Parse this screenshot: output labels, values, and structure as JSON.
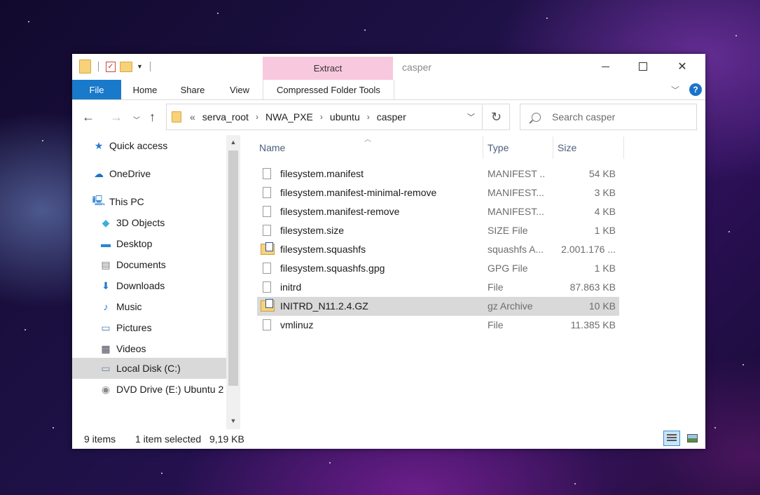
{
  "window": {
    "title": "casper",
    "context_tab_group": "Extract",
    "ribbon_tabs": [
      "File",
      "Home",
      "Share",
      "View",
      "Compressed Folder Tools"
    ],
    "accent_color": "#1979ca",
    "context_color": "#f8c8de"
  },
  "address": {
    "lead": "«",
    "crumbs": [
      "serva_root",
      "NWA_PXE",
      "ubuntu",
      "casper"
    ]
  },
  "search": {
    "placeholder": "Search casper"
  },
  "nav": {
    "items": [
      {
        "label": "Quick access",
        "icon": "star-icon"
      },
      {
        "label": "OneDrive",
        "icon": "cloud-icon"
      },
      {
        "label": "This PC",
        "icon": "computer-icon"
      },
      {
        "label": "3D Objects",
        "icon": "cube-icon"
      },
      {
        "label": "Desktop",
        "icon": "desktop-icon"
      },
      {
        "label": "Documents",
        "icon": "document-icon"
      },
      {
        "label": "Downloads",
        "icon": "download-arrow-icon"
      },
      {
        "label": "Music",
        "icon": "music-note-icon"
      },
      {
        "label": "Pictures",
        "icon": "picture-icon"
      },
      {
        "label": "Videos",
        "icon": "film-icon"
      },
      {
        "label": "Local Disk (C:)",
        "icon": "drive-icon"
      },
      {
        "label": "DVD Drive (E:) Ubuntu 2",
        "icon": "dvd-icon"
      }
    ]
  },
  "columns": {
    "name": "Name",
    "type": "Type",
    "size": "Size"
  },
  "files": [
    {
      "name": "filesystem.manifest",
      "type": "MANIFEST ...",
      "size": "54 KB",
      "kind": "file"
    },
    {
      "name": "filesystem.manifest-minimal-remove",
      "type": "MANIFEST...",
      "size": "3 KB",
      "kind": "file"
    },
    {
      "name": "filesystem.manifest-remove",
      "type": "MANIFEST...",
      "size": "4 KB",
      "kind": "file"
    },
    {
      "name": "filesystem.size",
      "type": "SIZE File",
      "size": "1 KB",
      "kind": "file"
    },
    {
      "name": "filesystem.squashfs",
      "type": "squashfs A...",
      "size": "2.001.176 ...",
      "kind": "archive"
    },
    {
      "name": "filesystem.squashfs.gpg",
      "type": "GPG File",
      "size": "1 KB",
      "kind": "file"
    },
    {
      "name": "initrd",
      "type": "File",
      "size": "87.863 KB",
      "kind": "file"
    },
    {
      "name": "INITRD_N11.2.4.GZ",
      "type": "gz Archive",
      "size": "10 KB",
      "kind": "archive",
      "selected": true
    },
    {
      "name": "vmlinuz",
      "type": "File",
      "size": "11.385 KB",
      "kind": "file"
    }
  ],
  "status": {
    "item_count": "9 items",
    "selection": "1 item selected",
    "selection_size": "9,19 KB"
  }
}
